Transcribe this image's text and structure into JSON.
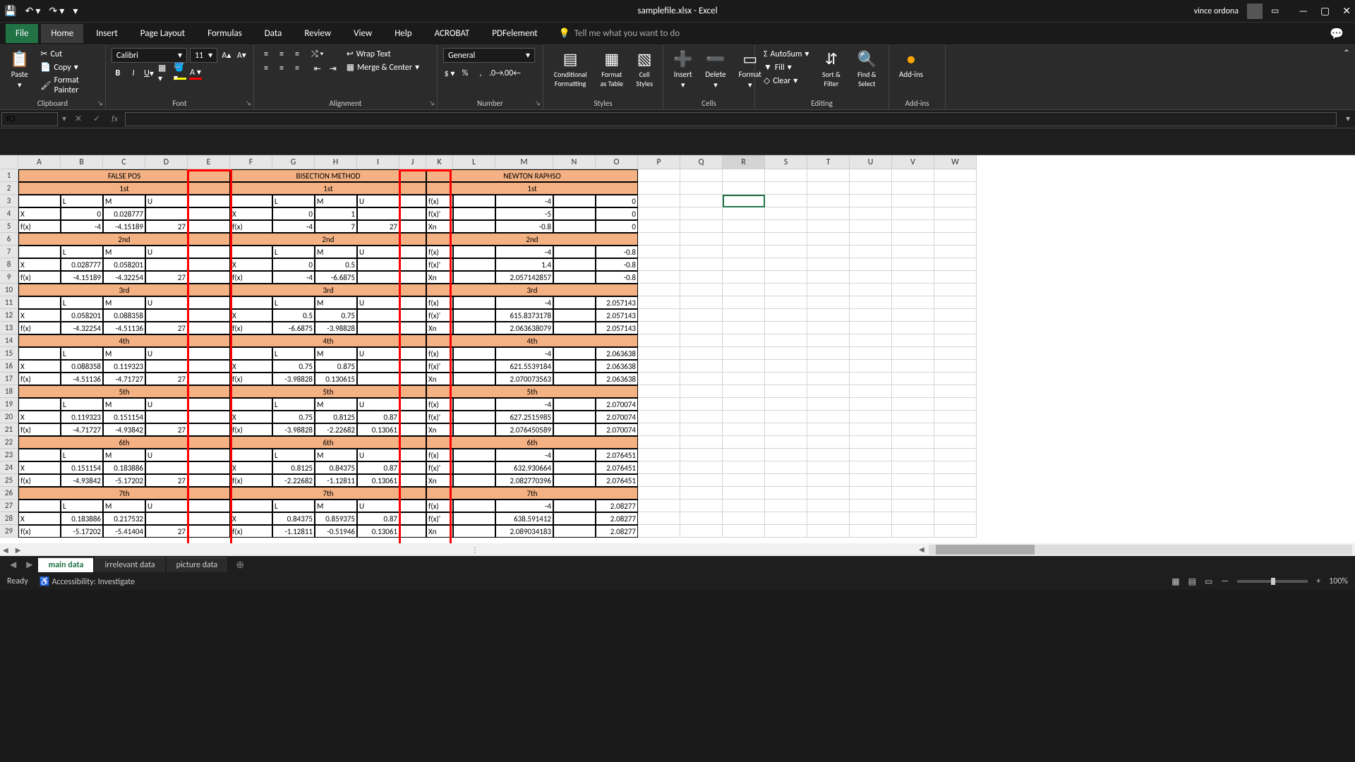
{
  "app": {
    "title": "samplefile.xlsx - Excel",
    "user": "vince ordona"
  },
  "menu": {
    "file": "File",
    "home": "Home",
    "insert": "Insert",
    "pagelayout": "Page Layout",
    "formulas": "Formulas",
    "data": "Data",
    "review": "Review",
    "view": "View",
    "help": "Help",
    "acrobat": "ACROBAT",
    "pdfelement": "PDFelement",
    "tellme": "Tell me what you want to do"
  },
  "ribbon": {
    "clipboard": {
      "paste": "Paste",
      "cut": "Cut",
      "copy": "Copy",
      "painter": "Format Painter",
      "label": "Clipboard"
    },
    "font": {
      "name": "Calibri",
      "size": "11",
      "label": "Font"
    },
    "alignment": {
      "wrap": "Wrap Text",
      "merge": "Merge & Center",
      "label": "Alignment"
    },
    "number": {
      "format": "General",
      "label": "Number"
    },
    "styles": {
      "cond": "Conditional Formatting",
      "fmtTable": "Format as Table",
      "cellStyles": "Cell Styles",
      "label": "Styles"
    },
    "cells": {
      "insert": "Insert",
      "delete": "Delete",
      "format": "Format",
      "label": "Cells"
    },
    "editing": {
      "autosum": "AutoSum",
      "fill": "Fill",
      "clear": "Clear",
      "sort": "Sort & Filter",
      "find": "Find & Select",
      "label": "Editing"
    },
    "addins": {
      "addins": "Add-ins",
      "label": "Add-ins"
    }
  },
  "namebox": "R3",
  "columns": [
    "A",
    "B",
    "C",
    "D",
    "E",
    "F",
    "G",
    "H",
    "I",
    "J",
    "K",
    "L",
    "M",
    "N",
    "O",
    "P",
    "Q",
    "R",
    "S",
    "T",
    "U",
    "V",
    "W"
  ],
  "rows": [
    {
      "n": "1",
      "cells": {
        "A": "FALSE POS",
        "F": "BISECTION METHOD",
        "K": "NEWTON RAPHSO"
      }
    },
    {
      "n": "2",
      "cells": {
        "A": "1st",
        "F": "1st",
        "K": "1st"
      }
    },
    {
      "n": "3",
      "cells": {
        "B": "L",
        "C": "M",
        "D": "U",
        "G": "L",
        "H": "M",
        "I": "U",
        "K": "f(x)",
        "M": "-4",
        "O": "0"
      }
    },
    {
      "n": "4",
      "cells": {
        "A": "X",
        "B": "0",
        "C": "0.028777",
        "F": "X",
        "G": "0",
        "H": "1",
        "K": "f(x)'",
        "M": "-5",
        "O": "0"
      }
    },
    {
      "n": "5",
      "cells": {
        "A": "f(x)",
        "B": "-4",
        "C": "-4.15189",
        "D": "27",
        "F": "f(x)",
        "G": "-4",
        "H": "7",
        "I": "27",
        "K": "Xn",
        "M": "-0.8",
        "O": "0"
      }
    },
    {
      "n": "6",
      "cells": {
        "A": "2nd",
        "F": "2nd",
        "K": "2nd"
      }
    },
    {
      "n": "7",
      "cells": {
        "B": "L",
        "C": "M",
        "D": "U",
        "G": "L",
        "H": "M",
        "I": "U",
        "K": "f(x)",
        "M": "-4",
        "O": "-0.8"
      }
    },
    {
      "n": "8",
      "cells": {
        "A": "X",
        "B": "0.028777",
        "C": "0.058201",
        "F": "X",
        "G": "0",
        "H": "0.5",
        "K": "f(x)'",
        "M": "1.4",
        "O": "-0.8"
      }
    },
    {
      "n": "9",
      "cells": {
        "A": "f(x)",
        "B": "-4.15189",
        "C": "-4.32254",
        "D": "27",
        "F": "f(x)",
        "G": "-4",
        "H": "-6.6875",
        "K": "Xn",
        "M": "2.057142857",
        "O": "-0.8"
      }
    },
    {
      "n": "10",
      "cells": {
        "A": "3rd",
        "F": "3rd",
        "K": "3rd"
      }
    },
    {
      "n": "11",
      "cells": {
        "B": "L",
        "C": "M",
        "D": "U",
        "G": "L",
        "H": "M",
        "I": "U",
        "K": "f(x)",
        "M": "-4",
        "O": "2.057143"
      }
    },
    {
      "n": "12",
      "cells": {
        "A": "X",
        "B": "0.058201",
        "C": "0.088358",
        "F": "X",
        "G": "0.5",
        "H": "0.75",
        "K": "f(x)'",
        "M": "615.8373178",
        "O": "2.057143"
      }
    },
    {
      "n": "13",
      "cells": {
        "A": "f(x)",
        "B": "-4.32254",
        "C": "-4.51136",
        "D": "27",
        "F": "f(x)",
        "G": "-6.6875",
        "H": "-3.98828",
        "K": "Xn",
        "M": "2.063638079",
        "O": "2.057143"
      }
    },
    {
      "n": "14",
      "cells": {
        "A": "4th",
        "F": "4th",
        "K": "4th"
      }
    },
    {
      "n": "15",
      "cells": {
        "B": "L",
        "C": "M",
        "D": "U",
        "G": "L",
        "H": "M",
        "I": "U",
        "K": "f(x)",
        "M": "-4",
        "O": "2.063638"
      }
    },
    {
      "n": "16",
      "cells": {
        "A": "X",
        "B": "0.088358",
        "C": "0.119323",
        "F": "X",
        "G": "0.75",
        "H": "0.875",
        "K": "f(x)'",
        "M": "621.5539184",
        "O": "2.063638"
      }
    },
    {
      "n": "17",
      "cells": {
        "A": "f(x)",
        "B": "-4.51136",
        "C": "-4.71727",
        "D": "27",
        "F": "f(x)",
        "G": "-3.98828",
        "H": "0.130615",
        "K": "Xn",
        "M": "2.070073563",
        "O": "2.063638"
      }
    },
    {
      "n": "18",
      "cells": {
        "A": "5th",
        "F": "5th",
        "K": "5th"
      }
    },
    {
      "n": "19",
      "cells": {
        "B": "L",
        "C": "M",
        "D": "U",
        "G": "L",
        "H": "M",
        "I": "U",
        "K": "f(x)",
        "M": "-4",
        "O": "2.070074"
      }
    },
    {
      "n": "20",
      "cells": {
        "A": "X",
        "B": "0.119323",
        "C": "0.151154",
        "F": "X",
        "G": "0.75",
        "H": "0.8125",
        "I": "0.87",
        "K": "f(x)'",
        "M": "627.2515985",
        "O": "2.070074"
      }
    },
    {
      "n": "21",
      "cells": {
        "A": "f(x)",
        "B": "-4.71727",
        "C": "-4.93842",
        "D": "27",
        "F": "f(x)",
        "G": "-3.98828",
        "H": "-2.22682",
        "I": "0.13061",
        "K": "Xn",
        "M": "2.076450589",
        "O": "2.070074"
      }
    },
    {
      "n": "22",
      "cells": {
        "A": "6th",
        "F": "6th",
        "K": "6th"
      }
    },
    {
      "n": "23",
      "cells": {
        "B": "L",
        "C": "M",
        "D": "U",
        "G": "L",
        "H": "M",
        "I": "U",
        "K": "f(x)",
        "M": "-4",
        "O": "2.076451"
      }
    },
    {
      "n": "24",
      "cells": {
        "A": "X",
        "B": "0.151154",
        "C": "0.183886",
        "F": "X",
        "G": "0.8125",
        "H": "0.84375",
        "I": "0.87",
        "K": "f(x)'",
        "M": "632.930664",
        "O": "2.076451"
      }
    },
    {
      "n": "25",
      "cells": {
        "A": "f(x)",
        "B": "-4.93842",
        "C": "-5.17202",
        "D": "27",
        "F": "f(x)",
        "G": "-2.22682",
        "H": "-1.12811",
        "I": "0.13061",
        "K": "Xn",
        "M": "2.082770396",
        "O": "2.076451"
      }
    },
    {
      "n": "26",
      "cells": {
        "A": "7th",
        "F": "7th",
        "K": "7th"
      }
    },
    {
      "n": "27",
      "cells": {
        "B": "L",
        "C": "M",
        "D": "U",
        "G": "L",
        "H": "M",
        "I": "U",
        "K": "f(x)",
        "M": "-4",
        "O": "2.08277"
      }
    },
    {
      "n": "28",
      "cells": {
        "A": "X",
        "B": "0.183886",
        "C": "0.217532",
        "F": "X",
        "G": "0.84375",
        "H": "0.859375",
        "I": "0.87",
        "K": "f(x)'",
        "M": "638.591412",
        "O": "2.08277"
      }
    },
    {
      "n": "29",
      "cells": {
        "A": "f(x)",
        "B": "-5.17202",
        "C": "-5.41404",
        "D": "27",
        "F": "f(x)",
        "G": "-1.12811",
        "H": "-0.51946",
        "I": "0.13061",
        "K": "Xn",
        "M": "2.089034183",
        "O": "2.08277"
      }
    }
  ],
  "headerRowsFP": [
    "1",
    "2",
    "6",
    "10",
    "14",
    "18",
    "22",
    "26"
  ],
  "tabs": {
    "main": "main data",
    "irr": "irrelevant data",
    "pic": "picture data"
  },
  "status": {
    "ready": "Ready",
    "acc": "Accessibility: Investigate",
    "zoom": "100%"
  }
}
